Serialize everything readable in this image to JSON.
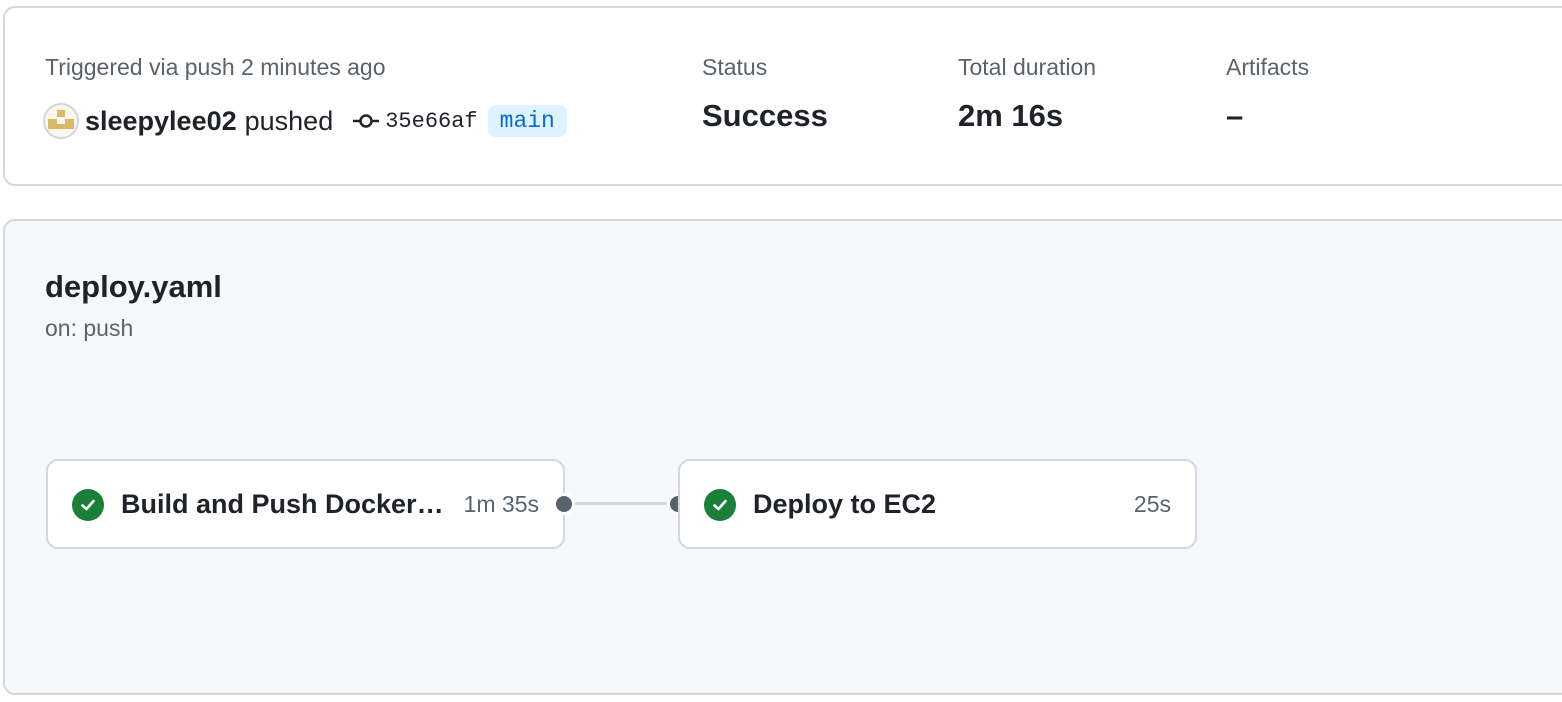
{
  "summary": {
    "trigger_text": "Triggered via push 2 minutes ago",
    "actor": "sleepylee02",
    "action": "pushed",
    "commit_sha": "35e66af",
    "branch": "main",
    "status_label": "Status",
    "status_value": "Success",
    "duration_label": "Total duration",
    "duration_value": "2m 16s",
    "artifacts_label": "Artifacts",
    "artifacts_value": "–"
  },
  "workflow": {
    "name": "deploy.yaml",
    "trigger": "on: push",
    "jobs": [
      {
        "name": "Build and Push Docker Image",
        "duration": "1m 35s",
        "status": "success"
      },
      {
        "name": "Deploy to EC2",
        "duration": "25s",
        "status": "success"
      }
    ]
  },
  "colors": {
    "success": "#1a7f37",
    "branch_bg": "#ddf4ff",
    "branch_fg": "#0969da",
    "muted": "#59636e",
    "border": "#d0d7de",
    "panel_bg": "#f6f8fa"
  },
  "icons": {
    "commit": "git-commit-icon",
    "job_status": "check-circle-icon",
    "avatar": "user-avatar"
  }
}
